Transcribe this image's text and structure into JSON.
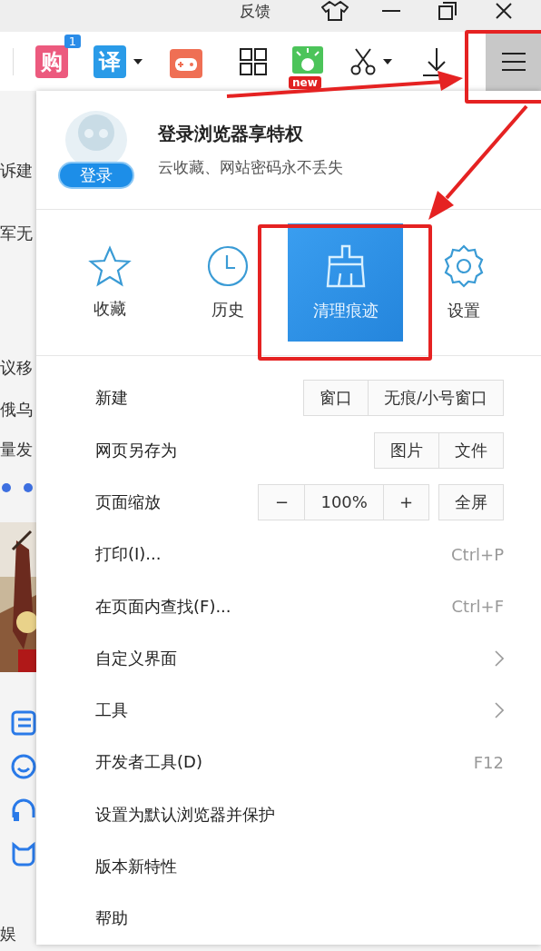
{
  "title_bar": {
    "feedback": "反馈"
  },
  "toolbar": {
    "shop_label": "购",
    "shop_badge": "1",
    "translate_label": "译",
    "new_badge": "new"
  },
  "page_fragments": [
    "诉建",
    "军无",
    "议移",
    "俄乌",
    "量发",
    "娱"
  ],
  "menu": {
    "login": {
      "title": "登录浏览器享特权",
      "subtitle": "云收藏、网站密码永不丢失",
      "button": "登录"
    },
    "quick_actions": [
      {
        "label": "收藏",
        "selected": false
      },
      {
        "label": "历史",
        "selected": false
      },
      {
        "label": "清理痕迹",
        "selected": true
      },
      {
        "label": "设置",
        "selected": false
      }
    ],
    "items": [
      {
        "kind": "buttons",
        "label": "新建",
        "groups": [
          [
            "窗口",
            "无痕/小号窗口"
          ]
        ]
      },
      {
        "kind": "buttons",
        "label": "网页另存为",
        "groups": [
          [
            "图片",
            "文件"
          ]
        ]
      },
      {
        "kind": "buttons",
        "label": "页面缩放",
        "groups": [
          [
            "−",
            "100%",
            "+"
          ],
          [
            "全屏"
          ]
        ]
      },
      {
        "kind": "shortcut",
        "label": "打印(I)...",
        "shortcut": "Ctrl+P"
      },
      {
        "kind": "shortcut",
        "label": "在页面内查找(F)...",
        "shortcut": "Ctrl+F"
      },
      {
        "kind": "submenu",
        "label": "自定义界面"
      },
      {
        "kind": "submenu",
        "label": "工具"
      },
      {
        "kind": "shortcut",
        "label": "开发者工具(D)",
        "shortcut": "F12"
      },
      {
        "kind": "plain",
        "label": "设置为默认浏览器并保护"
      },
      {
        "kind": "plain",
        "label": "版本新特性"
      },
      {
        "kind": "plain",
        "label": "帮助"
      }
    ]
  }
}
